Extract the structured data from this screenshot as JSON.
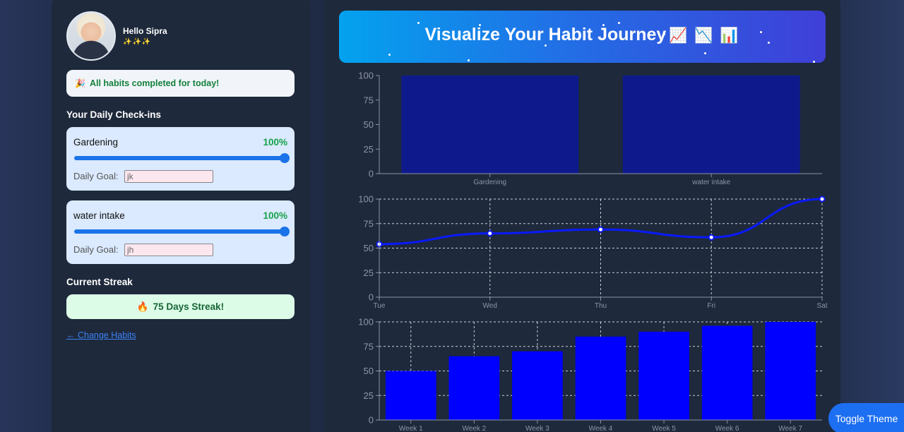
{
  "profile": {
    "greeting": "Hello Sipra",
    "sparkles": "✨✨✨"
  },
  "status_banner": {
    "icon": "🎉",
    "text": "All habits completed for today!"
  },
  "checkins": {
    "title": "Your Daily Check-ins",
    "goal_label": "Daily Goal:",
    "habits": [
      {
        "name": "Gardening",
        "percent_label": "100%",
        "progress": 1.0,
        "goal": "jk"
      },
      {
        "name": "water intake",
        "percent_label": "100%",
        "progress": 1.0,
        "goal": "jh"
      }
    ]
  },
  "streak": {
    "title": "Current Streak",
    "icon": "🔥",
    "text": "75 Days Streak!"
  },
  "change_link": "← Change Habits",
  "hero": {
    "title": "Visualize Your Habit Journey",
    "emojis": "📈 📉 📊"
  },
  "toggle_label": "Toggle Theme",
  "colors": {
    "accent": "#1d6ff2",
    "success": "#16a34a",
    "bar1": "#0e1a8c",
    "bar3": "#0000ff",
    "line": "#0a1aff"
  },
  "chart_data": [
    {
      "type": "bar",
      "categories": [
        "Gardening",
        "water intake"
      ],
      "values": [
        100,
        100
      ],
      "ylim": [
        0,
        100
      ],
      "yticks": [
        0,
        25,
        50,
        75,
        100
      ],
      "grid": false
    },
    {
      "type": "line",
      "categories": [
        "Tue",
        "Wed",
        "Thu",
        "Fri",
        "Sat"
      ],
      "values": [
        54,
        65,
        69,
        61,
        100
      ],
      "ylim": [
        0,
        100
      ],
      "yticks": [
        0,
        25,
        50,
        75,
        100
      ],
      "grid": true
    },
    {
      "type": "bar",
      "categories": [
        "Week 1",
        "Week 2",
        "Week 3",
        "Week 4",
        "Week 5",
        "Week 6",
        "Week 7"
      ],
      "values": [
        50,
        65,
        70,
        85,
        90,
        96,
        100
      ],
      "ylim": [
        0,
        100
      ],
      "yticks": [
        0,
        25,
        50,
        75,
        100
      ],
      "grid": true
    }
  ]
}
